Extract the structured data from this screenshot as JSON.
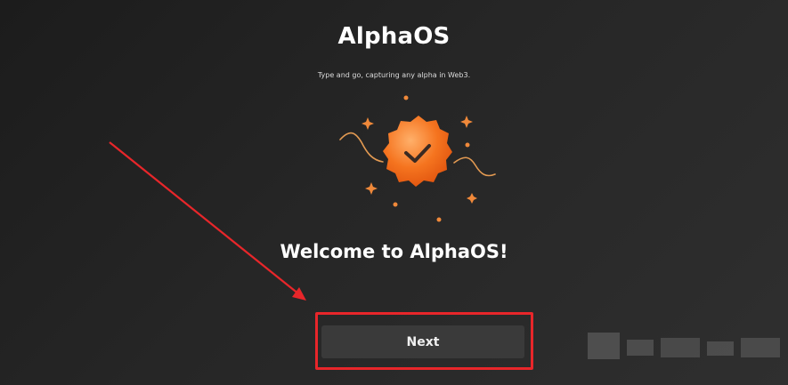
{
  "header": {
    "title": "AlphaOS",
    "subtitle": "Type and go, capturing any alpha in Web3."
  },
  "main": {
    "welcome_text": "Welcome to AlphaOS!",
    "next_label": "Next",
    "badge_icon": "verified-check-badge-icon"
  },
  "colors": {
    "accent_orange": "#f26a1b",
    "highlight_red": "#e8262a",
    "button_bg": "#3a3a3a"
  }
}
